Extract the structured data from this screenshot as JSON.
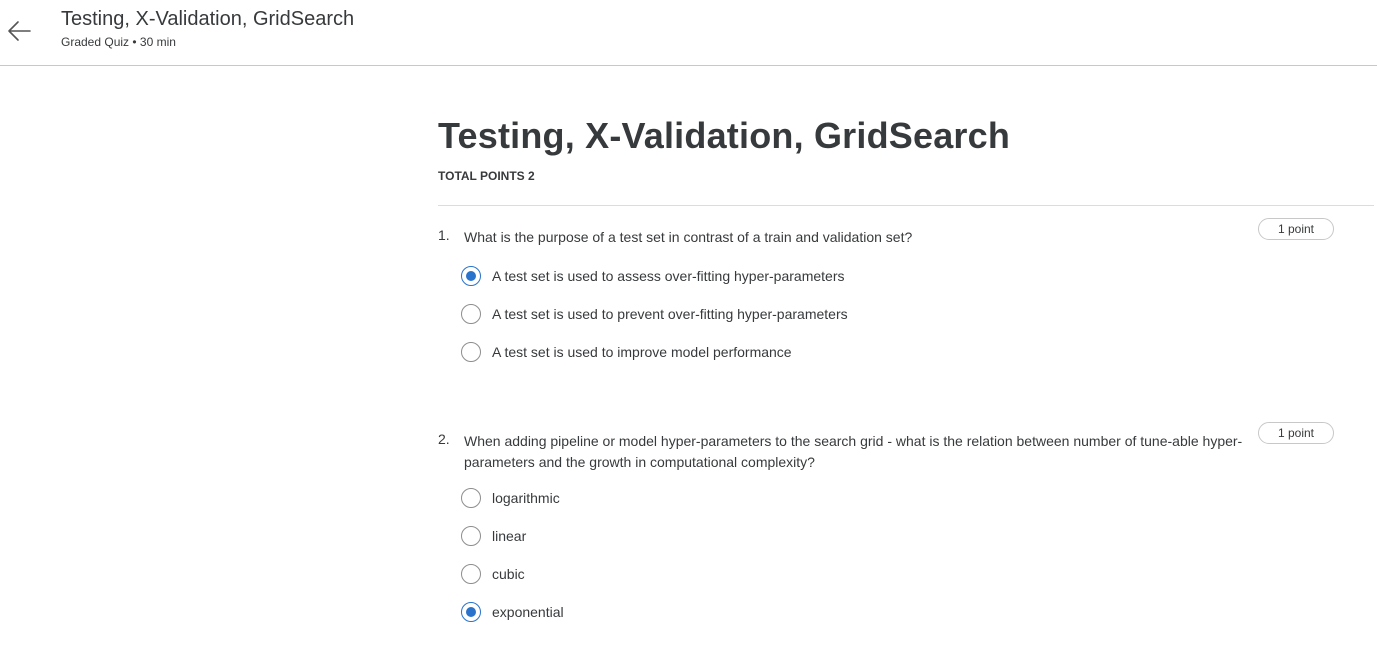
{
  "header": {
    "title": "Testing, X-Validation, GridSearch",
    "subtitle": "Graded Quiz • 30 min",
    "back_icon": "arrow-left-icon"
  },
  "main": {
    "title": "Testing, X-Validation, GridSearch",
    "total_points": "TOTAL POINTS 2"
  },
  "questions": [
    {
      "number": "1.",
      "text": "What is the purpose of a test set in contrast of a train and validation set?",
      "points": "1 point",
      "options": [
        {
          "label": "A test set is used to assess over-fitting hyper-parameters",
          "selected": true
        },
        {
          "label": "A test set is used to prevent over-fitting hyper-parameters",
          "selected": false
        },
        {
          "label": "A test set is used to improve model performance",
          "selected": false
        }
      ]
    },
    {
      "number": "2.",
      "text": "When adding pipeline or model hyper-parameters to the search grid - what is the relation between number of tune-able hyper-parameters and the growth in computational complexity?",
      "points": "1 point",
      "options": [
        {
          "label": "logarithmic",
          "selected": false
        },
        {
          "label": "linear",
          "selected": false
        },
        {
          "label": "cubic",
          "selected": false
        },
        {
          "label": "exponential",
          "selected": true
        }
      ]
    }
  ],
  "colors": {
    "accent": "#2a73cc",
    "text": "#373a3c",
    "border": "#c8c8c8"
  }
}
